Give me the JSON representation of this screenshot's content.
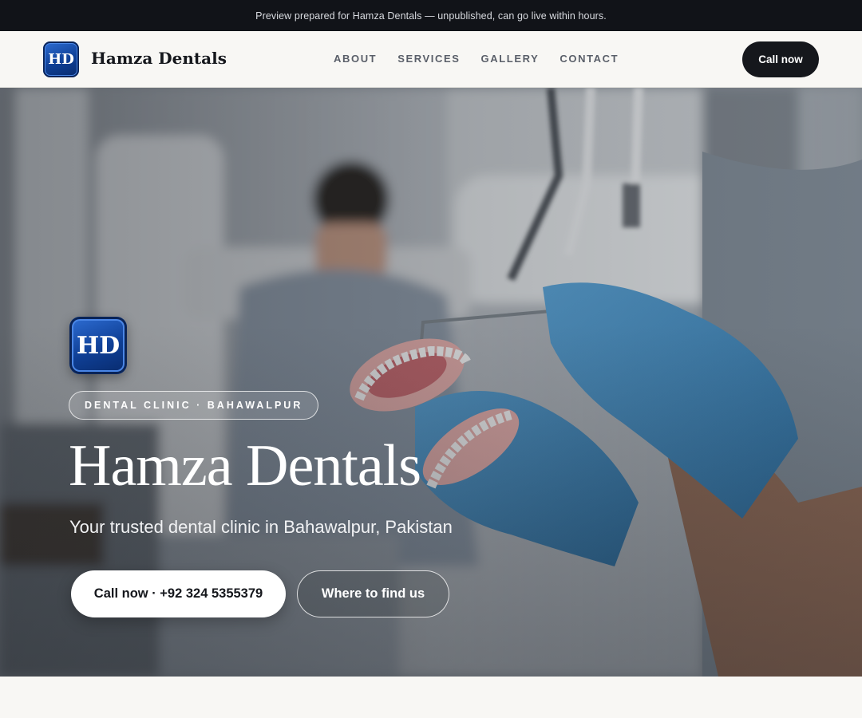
{
  "banner": {
    "text": "Preview prepared for Hamza Dentals — unpublished, can go live within hours."
  },
  "header": {
    "logo_text": "HD",
    "brand": "Hamza Dentals",
    "nav": [
      "ABOUT",
      "SERVICES",
      "GALLERY",
      "CONTACT"
    ],
    "cta_label": "Call now"
  },
  "hero": {
    "logo_text": "HD",
    "tag": "DENTAL CLINIC · BAHAWALPUR",
    "title": "Hamza Dentals",
    "subtitle": "Your trusted dental clinic in Bahawalpur, Pakistan",
    "primary_button": "Call now · +92 324 5355379",
    "secondary_button": "Where to find us",
    "background_image": "dentist-holding-denture-model-photo"
  },
  "colors": {
    "banner_bg": "#111318",
    "header_bg": "#f8f7f4",
    "dark": "#15171c",
    "logo_blue": "#1246a8",
    "glove_blue": "#4a93c9"
  }
}
